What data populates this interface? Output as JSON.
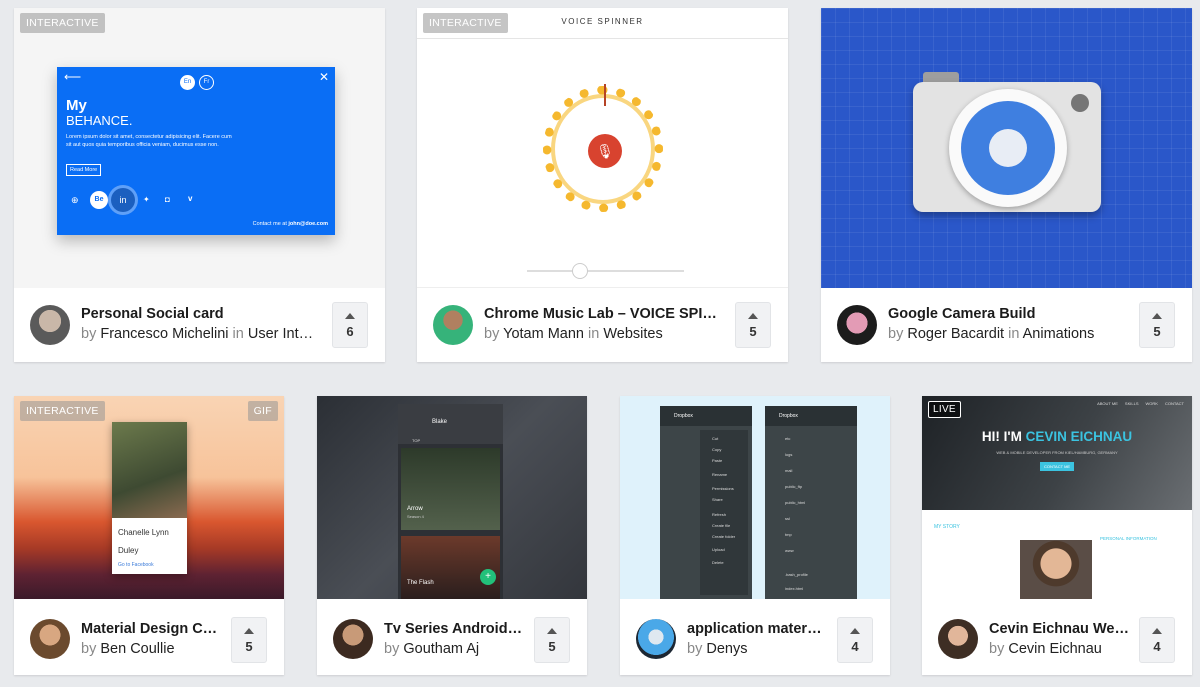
{
  "cards": [
    {
      "title": "Personal Social card",
      "by_prefix": "by",
      "author": "Francesco Michelini",
      "in_word": "in",
      "category": "User Inter…",
      "votes": "6",
      "badge": "INTERACTIVE",
      "preview": {
        "heading1": "My",
        "heading2": "BEHANCE.",
        "body": "Lorem ipsum dolor sit amet, consectetur adipisicing elit. Facere cum sit aut quos quia temporibus officia veniam, ducimus esse non.",
        "read_more": "Read More",
        "lang1": "En",
        "lang2": "Fr",
        "contact_prefix": "Contact me at",
        "contact_email": "john@doe.com",
        "social_be": "Be",
        "social_in": "in"
      }
    },
    {
      "title": "Chrome Music Lab – VOICE SPINN…",
      "by_prefix": "by",
      "author": "Yotam Mann",
      "in_word": "in",
      "category": "Websites",
      "votes": "5",
      "badge": "INTERACTIVE",
      "preview": {
        "heading": "VOICE SPINNER"
      }
    },
    {
      "title": "Google Camera Build",
      "by_prefix": "by",
      "author": "Roger Bacardit",
      "in_word": "in",
      "category": "Animations",
      "votes": "5"
    },
    {
      "title": "Material Design Ca…",
      "by_prefix": "by",
      "author": "Ben Coullie",
      "votes": "5",
      "badge": "INTERACTIVE",
      "badge2": "GIF",
      "preview": {
        "name1": "Chanelle Lynn",
        "name2": "Duley",
        "link": "Go to Facebook"
      }
    },
    {
      "title": "Tv Series Android …",
      "by_prefix": "by",
      "author": "Goutham Aj",
      "votes": "5",
      "preview": {
        "user": "Blake",
        "tab_top": "TOP",
        "show1": "Arrow",
        "show1_sub": "Season 4",
        "show2": "The Flash"
      }
    },
    {
      "title": "application matera…",
      "by_prefix": "by",
      "author": "Denys",
      "votes": "4",
      "preview": {
        "app": "Dropbox",
        "folders": [
          "etc",
          "logs",
          "mail",
          "public_ftp",
          "public_html",
          "ssl",
          "tmp",
          "www",
          ".bash_profile",
          "index.html"
        ],
        "menu": [
          "Cut",
          "Copy",
          "Paste",
          "Rename",
          "Permissions",
          "Share",
          "Refresh",
          "Create file",
          "Create folder",
          "Upload",
          "Delete"
        ]
      }
    },
    {
      "title": "Cevin Eichnau Web…",
      "by_prefix": "by",
      "author": "Cevin Eichnau",
      "votes": "4",
      "badge": "LIVE",
      "preview": {
        "hero_prefix": "HI! I'M",
        "hero_name": "CEVIN EICHNAU",
        "hero_sub": "WEB & MOBILE DEVELOPER FROM KIEL/HAMBURG, GERMANY",
        "cta": "CONTACT ME",
        "story": "MY STORY",
        "personal": "PERSONAL INFORMATION",
        "nav": [
          "ABOUT ME",
          "SKILLS",
          "WORK",
          "CONTACT"
        ]
      }
    }
  ]
}
